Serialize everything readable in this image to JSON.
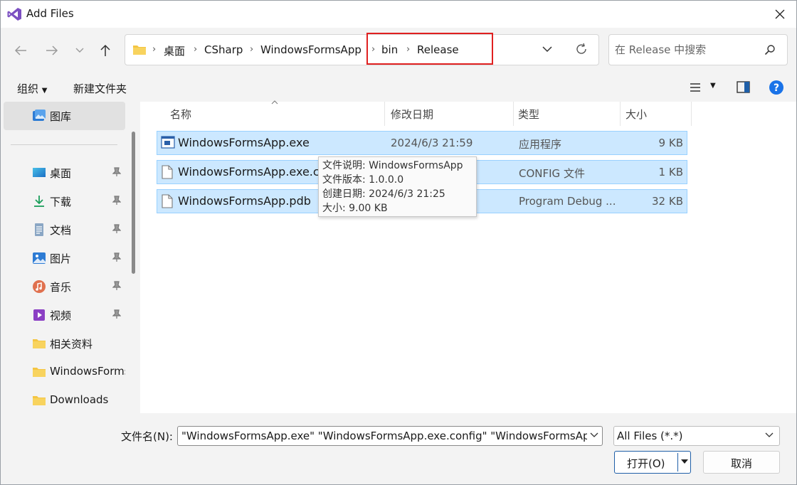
{
  "window": {
    "title": "Add Files"
  },
  "breadcrumb": [
    "桌面",
    "CSharp",
    "WindowsFormsApp",
    "bin",
    "Release"
  ],
  "search": {
    "placeholder": "在 Release 中搜索"
  },
  "toolbar": {
    "organize": "组织",
    "new_folder": "新建文件夹"
  },
  "sidebar": {
    "items": [
      {
        "label": "图库",
        "icon": "gallery-icon",
        "pinned": false
      },
      {
        "label": "桌面",
        "icon": "desktop-icon",
        "pinned": true
      },
      {
        "label": "下载",
        "icon": "download-icon",
        "pinned": true
      },
      {
        "label": "文档",
        "icon": "document-icon",
        "pinned": true
      },
      {
        "label": "图片",
        "icon": "pictures-icon",
        "pinned": true
      },
      {
        "label": "音乐",
        "icon": "music-icon",
        "pinned": true
      },
      {
        "label": "视频",
        "icon": "video-icon",
        "pinned": true
      },
      {
        "label": "相关资料",
        "icon": "folder-icon",
        "pinned": false
      },
      {
        "label": "WindowsFormsApp",
        "icon": "folder-icon",
        "pinned": false
      },
      {
        "label": "Downloads",
        "icon": "folder-icon",
        "pinned": false
      }
    ]
  },
  "columns": {
    "name": "名称",
    "date": "修改日期",
    "type": "类型",
    "size": "大小"
  },
  "files": [
    {
      "name": "WindowsFormsApp.exe",
      "date": "2024/6/3 21:59",
      "type": "应用程序",
      "size": "9 KB",
      "icon": "exe-icon"
    },
    {
      "name": "WindowsFormsApp.exe.config",
      "date": "",
      "type": "CONFIG 文件",
      "size": "1 KB",
      "icon": "file-icon"
    },
    {
      "name": "WindowsFormsApp.pdb",
      "date": "",
      "type": "Program Debug ...",
      "size": "32 KB",
      "icon": "file-icon"
    }
  ],
  "tooltip": {
    "line1": "文件说明: WindowsFormsApp",
    "line2": "文件版本: 1.0.0.0",
    "line3": "创建日期: 2024/6/3 21:25",
    "line4": "大小: 9.00 KB"
  },
  "bottom": {
    "filename_label": "文件名(N):",
    "filename_value": "\"WindowsFormsApp.exe\" \"WindowsFormsApp.exe.config\" \"WindowsFormsApp.pdb\"",
    "filter": "All Files (*.*)",
    "open_label": "打开(O)",
    "cancel_label": "取消"
  },
  "colors": {
    "selection": "#cce8ff",
    "selection_border": "#99d1ff",
    "highlight": "#e02020",
    "accent": "#1f5fa8"
  }
}
